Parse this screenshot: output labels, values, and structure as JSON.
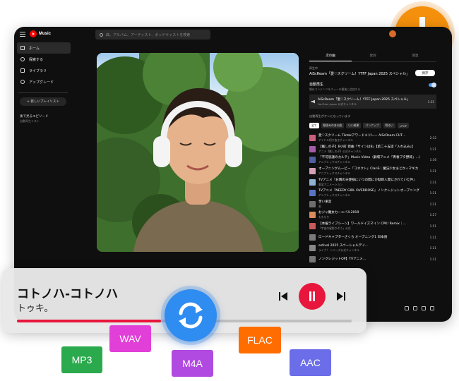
{
  "app": {
    "logo_text": "Music",
    "search_placeholder": "曲、アルバム、アーティスト、ポッドキャストを検索"
  },
  "sidebar": {
    "items": [
      {
        "label": "ホーム",
        "active": true
      },
      {
        "label": "探索する",
        "active": false
      },
      {
        "label": "ライブラリ",
        "active": false
      },
      {
        "label": "アップグレード",
        "active": false
      }
    ],
    "new_playlist": "+ 新しいプレイリスト",
    "saved_title": "後で見るエピソード",
    "saved_sub": "自動再生リスト"
  },
  "panel": {
    "tabs": [
      "次の曲",
      "歌詞",
      "関連"
    ],
    "up_label": "再生中",
    "up_title": "AiScReam「愛♡スクリーム！YTFF Japan 2025 スペシャル」",
    "save_label": "保存",
    "autoplay_title": "自動再生",
    "autoplay_sub": "類似コンテンツをキューの最後に追加する",
    "current": {
      "title": "AiScReam「愛♡スクリーム！YTFF Japan 2025 スペシャル」",
      "sub": "YouTube Japan 公式チャンネル",
      "duration": "1:35"
    },
    "mix_label": "自動再生がオンになっています",
    "chips": [
      "全て",
      "馴染みのある曲",
      "いい結果",
      "パンアップ",
      "明るい",
      "J-POP"
    ],
    "tracks": [
      {
        "title": "愛♡スクリーム Tiktokアワードメドレー AiScReam CUT…",
        "sub": "アイドル切り抜きチャンネル",
        "dur": "2:32",
        "color": "#c95f7d"
      },
      {
        "title": "【推しの子】B小町 新曲「サインはB」【第二十五話「入れ込み」】",
        "sub": "アニメ【推しの子】公式チャンネル",
        "dur": "1:31",
        "color": "#a45ba8"
      },
      {
        "title": "「不可思議のカルテ」Music Video（劇場アニメ「青春ブタ野郎」…）",
        "sub": "アニプレックスチャンネル",
        "dur": "1:36",
        "color": "#4f5fa0"
      },
      {
        "title": "オープニングムービー「コネクト」ClariS｜魔法少女まどか☆マギカ",
        "sub": "アニプレックスチャンネル",
        "dur": "1:31",
        "color": "#d4a0b5"
      },
      {
        "title": "TVアニメ『お隣の天使様にいつの間にか駄目人間にされていた件』",
        "sub": "東宝アニメーション",
        "dur": "1:31",
        "color": "#8fb2d0"
      },
      {
        "title": "TVアニメ『NEEDY GIRL OVERDOSE』ノンクレジットオープニング",
        "sub": "アニプレックスチャンネル",
        "dur": "1:31",
        "color": "#5a74c4"
      },
      {
        "title": "苦い果実",
        "sub": "雨",
        "dur": "1:31",
        "color": "#6e6e6e"
      },
      {
        "title": "おジャ魔女カーニバル2019",
        "sub": "もももり",
        "dur": "1:27",
        "color": "#d88a5a"
      },
      {
        "title": "【本編ライブシーン】ワールドイズマイン CPK! Remix｜…",
        "sub": "「宇宙の星影かぞう」公式",
        "dur": "1:51",
        "color": "#c75a5a"
      },
      {
        "title": "ロードキャプターさくら オープニング1 日本語",
        "sub": "",
        "dur": "1:21",
        "color": "#7a7a7a"
      },
      {
        "title": "estival 2025 スペーシャルデイ…",
        "sub": "ライブ！ シリーズ公式チャンネル",
        "dur": "1:21",
        "color": "#888"
      },
      {
        "title": "ノンクレジットOP】TVアニメ…",
        "sub": "",
        "dur": "1:31",
        "color": "#777"
      }
    ]
  },
  "player": {
    "title": "コトノハ-コトノハ",
    "artist": "トゥキ。",
    "progress": 0.43
  },
  "formats": [
    "MP3",
    "WAV",
    "M4A",
    "FLAC",
    "AAC"
  ],
  "colors": {
    "accent_red": "#e8163c",
    "download_orange": "#f4900c",
    "convert_blue": "#2f8cf0",
    "mp3": "#2aaa4c",
    "wav": "#e23fd8",
    "m4a": "#b04ae0",
    "flac": "#ff6d00",
    "aac": "#6b6ee8"
  }
}
